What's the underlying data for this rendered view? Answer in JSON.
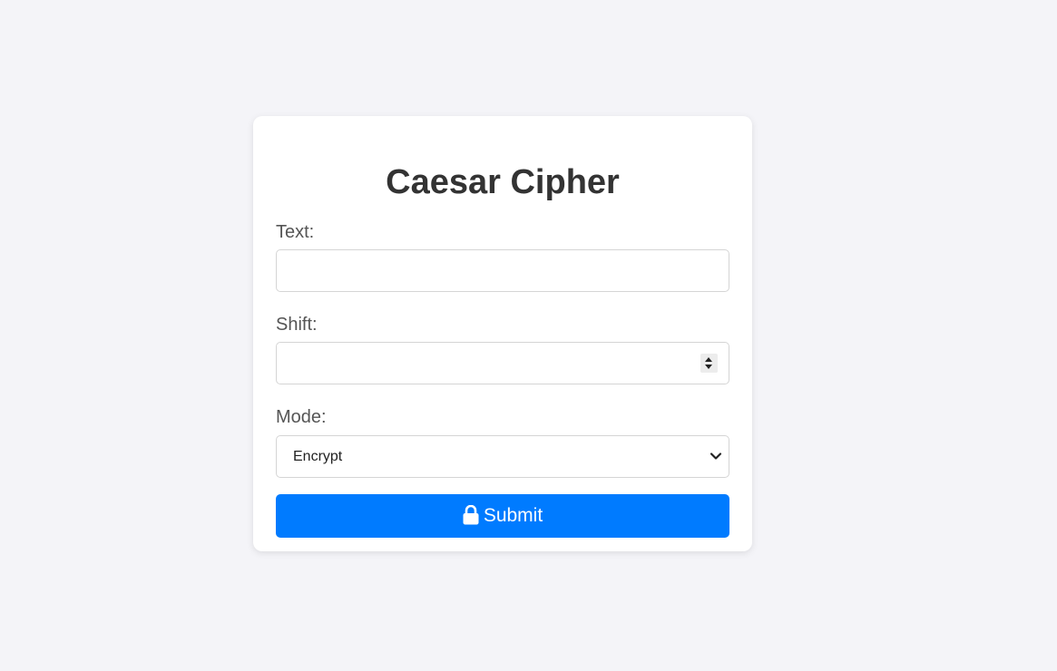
{
  "form": {
    "title": "Caesar Cipher",
    "text_label": "Text:",
    "text_value": "",
    "shift_label": "Shift:",
    "shift_value": "",
    "mode_label": "Mode:",
    "mode_selected": "Encrypt",
    "submit_label": "Submit",
    "submit_icon": "lock-icon"
  },
  "colors": {
    "page_background": "#f4f4f8",
    "card_background": "#ffffff",
    "accent": "#007bff",
    "title_text": "#333333",
    "label_text": "#555555"
  }
}
